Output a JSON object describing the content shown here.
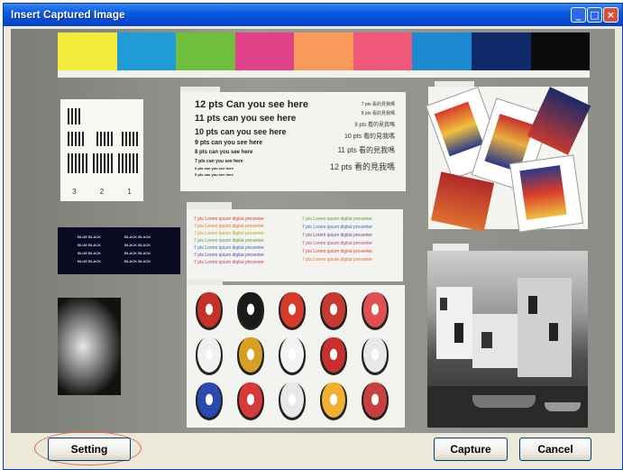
{
  "window": {
    "title": "Insert Captured Image",
    "minimize_icon": "minimize-icon",
    "maximize_icon": "maximize-icon",
    "close_icon": "close-icon"
  },
  "preview": {
    "color_strip": [
      "#f4ea3a",
      "#1f9bd8",
      "#6fbf3c",
      "#e0428a",
      "#f79a5a",
      "#f0587a",
      "#1c8ad0",
      "#0e2a6a",
      "#0a0a0a"
    ],
    "resolution_labels": [
      "3",
      "2",
      "1"
    ],
    "text_chart": {
      "label": "",
      "lines": [
        "12 pts Can you see here",
        "11 pts can you see here",
        "10 pts can you see here",
        "9 pts can you see here",
        "8 pts can you see here",
        "7 pts can you see here",
        "6 pts can you see here",
        "5 pts can you see here"
      ],
      "cjk_lines": [
        "7 pts 看的見我嗎",
        "8 pts 看的見我嗎",
        "9 pts 看的見我嗎",
        "10 pts 看的見我嗎",
        "11 pts 看的見我嗎",
        "12 pts 看的見我嗎"
      ]
    },
    "color_text": {
      "left_lines": [
        "7 pts Lorem ipsum digital presenter",
        "7 pts Lorem ipsum digital presenter",
        "7 pts Lorem ipsum digital presenter",
        "7 pts Lorem ipsum digital presenter",
        "7 pts Lorem ipsum digital presenter",
        "7 pts Lorem ipsum digital presenter",
        "7 pts Lorem ipsum digital presenter"
      ],
      "right_lines": [
        "7 pts Lorem ipsum digital presenter",
        "7 pts Lorem ipsum digital presenter",
        "7 pts Lorem ipsum digital presenter",
        "7 pts Lorem ipsum digital presenter",
        "7 pts Lorem ipsum digital presenter",
        "7 pts Lorem ipsum digital presenter"
      ],
      "colors": [
        "#e04040",
        "#e07030",
        "#c0a020",
        "#50a040",
        "#3070c0",
        "#7040a0",
        "#c04080"
      ]
    },
    "navy_text": [
      "BLUE BLACK",
      "BLACK BLACK",
      "BLUE BLACK",
      "BLACK BLACK",
      "BLUE BLACK",
      "BLACK BLACK",
      "BLUE BLACK",
      "BLACK BLACK"
    ]
  },
  "buttons": {
    "setting": "Setting",
    "capture": "Capture",
    "cancel": "Cancel"
  }
}
